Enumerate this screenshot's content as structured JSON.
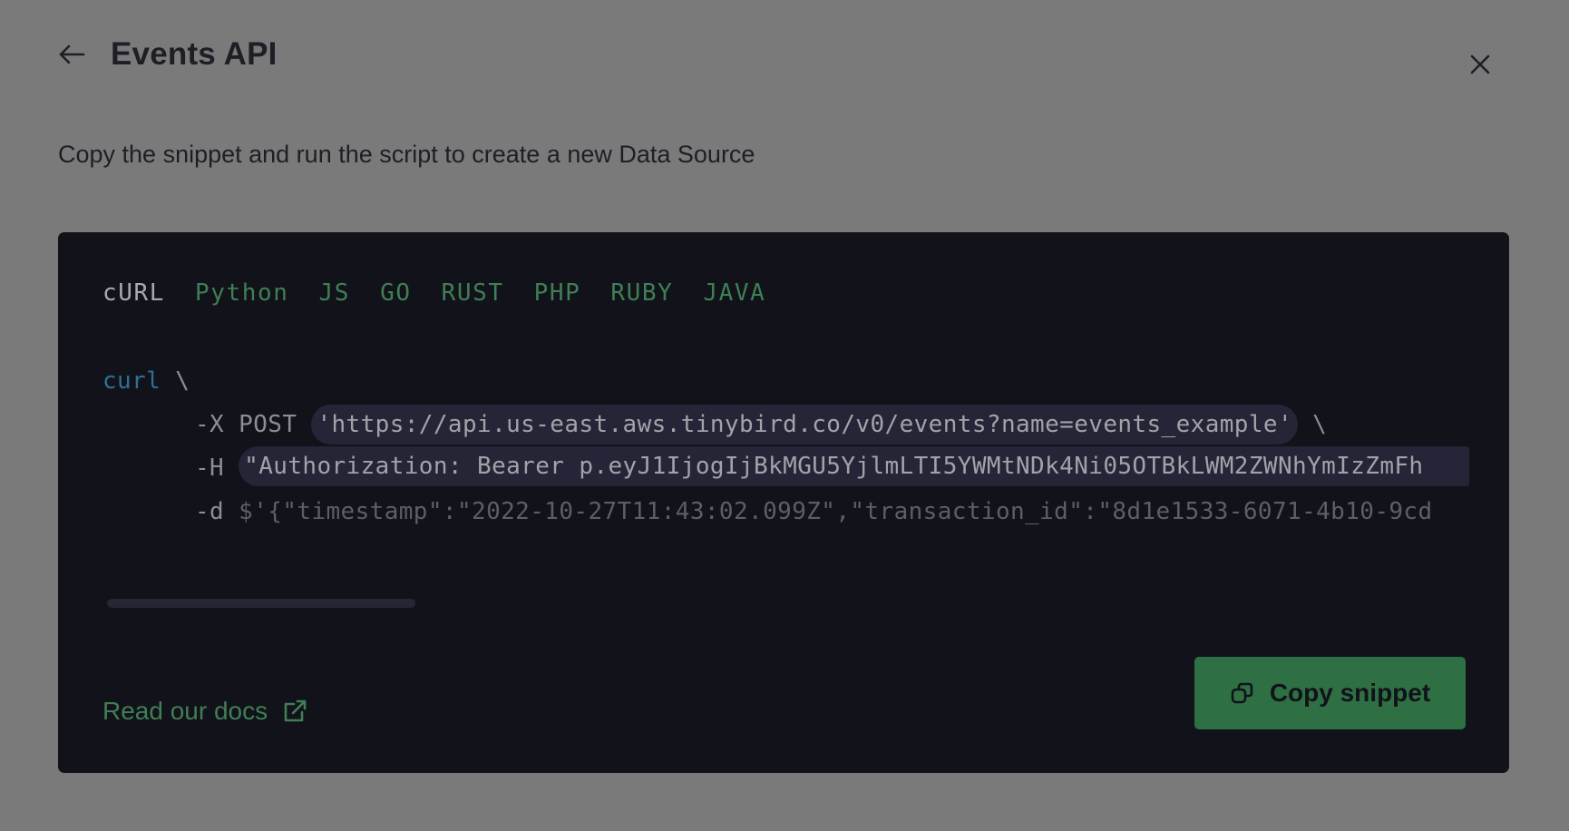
{
  "header": {
    "title": "Events API",
    "back_icon": "arrow-left-icon",
    "close_icon": "close-icon"
  },
  "description": "Copy the snippet and run the script to create a new Data Source",
  "tabs": [
    {
      "label": "cURL",
      "active": true
    },
    {
      "label": "Python",
      "active": false
    },
    {
      "label": "JS",
      "active": false
    },
    {
      "label": "GO",
      "active": false
    },
    {
      "label": "RUST",
      "active": false
    },
    {
      "label": "PHP",
      "active": false
    },
    {
      "label": "RUBY",
      "active": false
    },
    {
      "label": "JAVA",
      "active": false
    }
  ],
  "code": {
    "line1_cmd": "curl",
    "line1_cont": " \\",
    "line2_flag": "-X POST ",
    "line2_url": "'https://api.us-east.aws.tinybird.co/v0/events?name=events_example'",
    "line2_cont": " \\",
    "line3_flag": "-H ",
    "line3_header": "\"Authorization: Bearer p.eyJ1IjogIjBkMGU5YjlmLTI5YWMtNDk4Ni05OTBkLWM2ZWNhYmIzZmFh",
    "line4_flag": "-d ",
    "line4_data": "$'{\"timestamp\":\"2022-10-27T11:43:02.099Z\",\"transaction_id\":\"8d1e1533-6071-4b10-9cd"
  },
  "footer": {
    "docs_label": "Read our docs",
    "docs_icon": "external-link-icon",
    "copy_label": "Copy snippet",
    "copy_icon": "copy-icon"
  },
  "colors": {
    "backdrop": "#7a7a7a",
    "panel": "#12121b",
    "accent_green": "#2e7044",
    "tab_green": "#3f7f53"
  }
}
